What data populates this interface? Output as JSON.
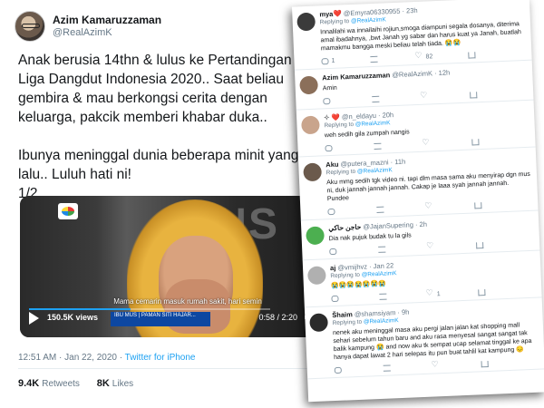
{
  "main_tweet": {
    "author_name": "Azim Kamaruzzaman",
    "author_handle": "@RealAzimK",
    "text": "Anak berusia 14thn & lulus ke Pertandingan Liga Dangdut Indonesia 2020.. Saat beliau gembira & mau berkongsi cerita dengan keluarga, pakcik memberi khabar duka..\n\nIbunya meninggal dunia beberapa minit yang lalu.. Luluh hati ni!\n1/2",
    "video": {
      "subtitle": "Mama cemarin masuk rumah sakit, hari semin",
      "lower_third": "IBU MUS | PAMAN SITI HAJAR...",
      "views": "150.5K views",
      "time": "0:58 / 2:20",
      "progress": 0.42,
      "bg_letters": "ONS"
    },
    "timestamp": "12:51 AM · Jan 22, 2020 · ",
    "via": "Twitter for iPhone",
    "retweets_count": "9.4K",
    "retweets_label": "Retweets",
    "likes_count": "8K",
    "likes_label": "Likes"
  },
  "replies": [
    {
      "name": "mya❤️",
      "handle": "@Emyra06330955 · 23h",
      "replying_prefix": "Replying to",
      "replying_to": "@RealAzimK",
      "text": "Innalilahi wa innailaihi rojiun,smoga diampuni segala dosanya, diterima amal ibadahnya, ,bwt Janah yg sabar dan harus kuat ya Janah, buatlah mamakmu bangga meski beliau telah tiada. 😭😭",
      "reply_count": "1",
      "retweet_count": "",
      "like_count": "82",
      "avatar_color": "#3b3b3b"
    },
    {
      "name": "Azim Kamaruzzaman",
      "handle": "@RealAzimK · 12h",
      "replying_prefix": "",
      "replying_to": "",
      "text": "Amin",
      "reply_count": "",
      "retweet_count": "",
      "like_count": "",
      "avatar_color": "#8b6f5a"
    },
    {
      "name": "✧ ❤️",
      "handle": "@n_eldayu · 20h",
      "replying_prefix": "Replying to",
      "replying_to": "@RealAzimK",
      "text": "weh sedih gila zumpah nangis",
      "reply_count": "",
      "retweet_count": "",
      "like_count": "",
      "avatar_color": "#c9a48c"
    },
    {
      "name": "Aku",
      "handle": "@putera_mazni · 11h",
      "replying_prefix": "Replying to",
      "replying_to": "@RealAzimK",
      "text": "Aku mmg sedih tgk video ni. tapi dlm masa sama aku menyirap dgn mus ni, duk jannah jannah jannah. Cakap je laaa syah jannah jannah. Pundee",
      "reply_count": "",
      "retweet_count": "",
      "like_count": "",
      "avatar_color": "#6b5a4c"
    },
    {
      "name": "حاجن حاكي",
      "handle": "@JajanSupering · 2h",
      "replying_prefix": "",
      "replying_to": "",
      "text": "Dia nak pujuk budak tu la gils",
      "reply_count": "",
      "retweet_count": "",
      "like_count": "",
      "avatar_color": "#4caf50"
    },
    {
      "name": "aj",
      "handle": "@vmijhvz · Jan 22",
      "replying_prefix": "Replying to",
      "replying_to": "@RealAzimK",
      "text": "😭😭😭😭😭😭😭",
      "reply_count": "",
      "retweet_count": "",
      "like_count": "1",
      "avatar_color": "#b0b0b0"
    },
    {
      "name": "Šhaim",
      "handle": "@shamsiyam · 9h",
      "replying_prefix": "Replying to",
      "replying_to": "@RealAzimK",
      "text": "nenek aku meninggal masa aku pergi jalan jalan kat shopping mall sehari sebelum tahun baru and aku rasa menyesal sangat sangat tak balik kampung 😭 and now aku tk sempat ucap selamat tinggal ke apa hanya dapat lawat 2 hari selepas itu pun buat tahlil kat kampung 😔",
      "reply_count": "",
      "retweet_count": "",
      "like_count": "",
      "avatar_color": "#2b2b2b"
    }
  ],
  "colors": {
    "link": "#1da1f2",
    "text": "#14171a",
    "muted": "#657786"
  }
}
